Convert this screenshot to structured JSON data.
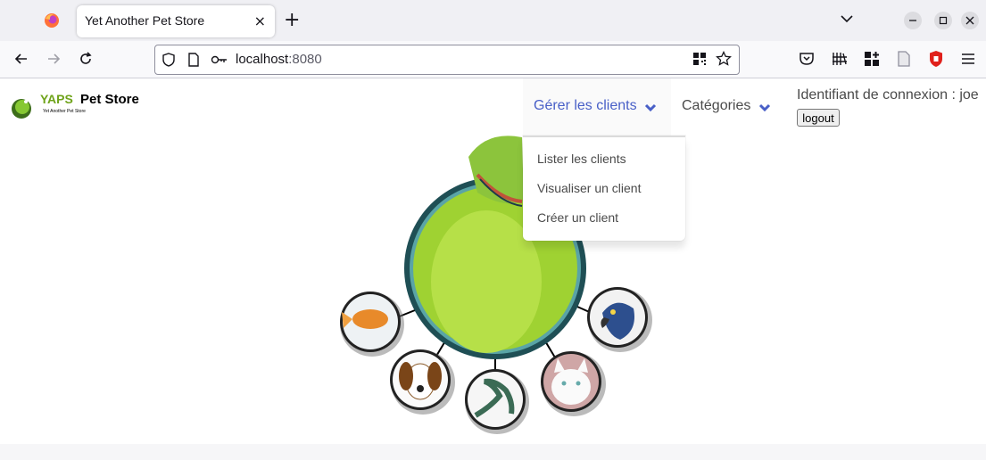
{
  "browser": {
    "tab_title": "Yet Another Pet Store",
    "tab_close": "×",
    "new_tab": "+",
    "url_host": "localhost",
    "url_port": ":8080"
  },
  "header": {
    "logo_yaps": "YAPS",
    "logo_name": "Pet Store",
    "logo_tagline": "Yet Another Pet Store"
  },
  "nav": {
    "clients_menu": "Gérer les clients",
    "categories_menu": "Catégories",
    "clients_items": [
      "Lister les clients",
      "Visualiser un client",
      "Créer un client"
    ]
  },
  "session": {
    "login_label": "Identifiant de connexion : joe",
    "logout_label": "logout"
  },
  "colors": {
    "link_active": "#485fc7",
    "text": "#4a4a4a"
  }
}
